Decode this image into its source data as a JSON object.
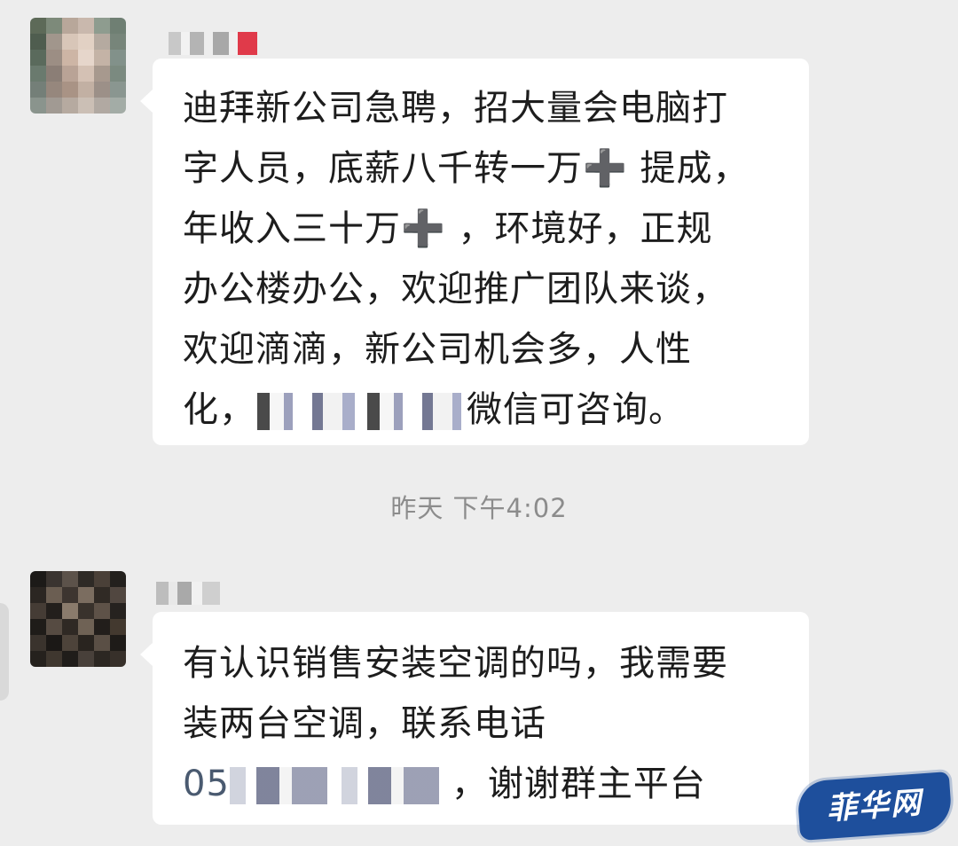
{
  "messages": [
    {
      "lines": [
        {
          "text": "迪拜新公司急聘，招大量会电脑打"
        },
        {
          "text": "字人员，底薪八千转一万➕ 提成，"
        },
        {
          "text": "年收入三十万➕ ，环境好，正规"
        },
        {
          "text": "办公楼办公，欢迎推广团队来谈，"
        },
        {
          "text": "欢迎滴滴，新公司机会多，人性"
        },
        {
          "text_before": "化，",
          "text_after": "微信可咨询。"
        }
      ]
    },
    {
      "lines": [
        {
          "text": "有认识销售安装空调的吗，我需要"
        },
        {
          "text": "装两台空调，联系电话"
        },
        {
          "text_before": "05",
          "text_after": "，谢谢群主平台"
        }
      ]
    }
  ],
  "timestamp": "昨天 下午4:02",
  "watermark": "菲华网",
  "colors": {
    "background": "#ededed",
    "bubble": "#ffffff",
    "text": "#1d1d1d",
    "timestamp": "#8c8c8c",
    "watermark_bg": "#1e4f9c"
  }
}
